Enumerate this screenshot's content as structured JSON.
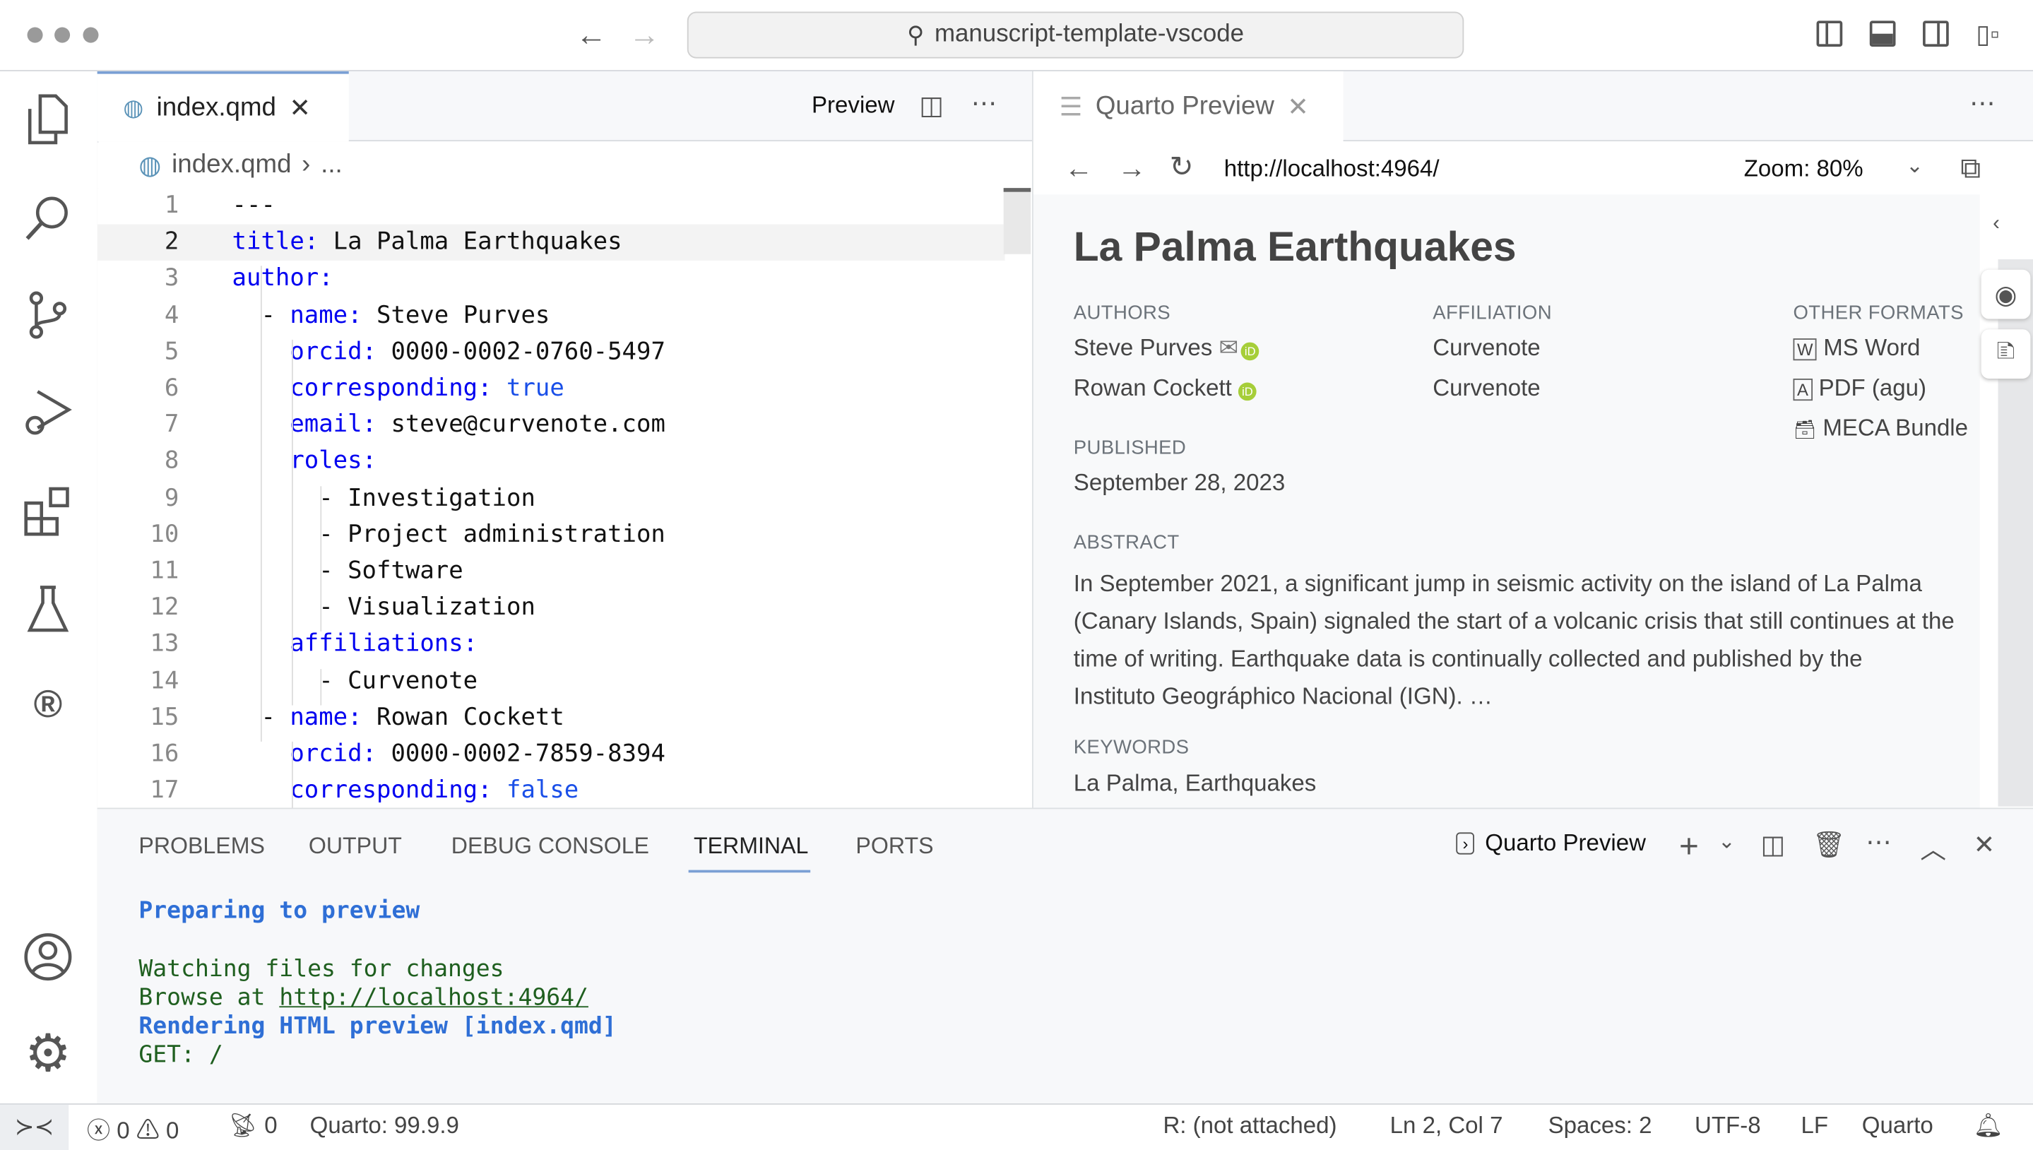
{
  "titlebar": {
    "search_text": "manuscript-template-vscode"
  },
  "activity_bar": {
    "items": [
      "explorer-icon",
      "search-icon",
      "source-control-icon",
      "run-debug-icon",
      "extensions-icon",
      "testing-icon",
      "r-icon"
    ],
    "bottom": [
      "account-icon",
      "gear-icon"
    ]
  },
  "editor": {
    "tab_label": "index.qmd",
    "preview_label": "Preview",
    "breadcrumb_file": "index.qmd",
    "breadcrumb_more": "...",
    "lines": [
      {
        "n": "1",
        "indent": "",
        "key": "",
        "val": "---"
      },
      {
        "n": "2",
        "indent": "",
        "key": "title:",
        "val": " La Palma Earthquakes"
      },
      {
        "n": "3",
        "indent": "",
        "key": "author:",
        "val": ""
      },
      {
        "n": "4",
        "indent": "  - ",
        "key": "name:",
        "val": " Steve Purves"
      },
      {
        "n": "5",
        "indent": "    ",
        "key": "orcid:",
        "val": " 0000-0002-0760-5497"
      },
      {
        "n": "6",
        "indent": "    ",
        "key": "corresponding:",
        "bool": " true"
      },
      {
        "n": "7",
        "indent": "    ",
        "key": "email:",
        "val": " steve@curvenote.com"
      },
      {
        "n": "8",
        "indent": "    ",
        "key": "roles:",
        "val": ""
      },
      {
        "n": "9",
        "indent": "      - ",
        "key": "",
        "val": "Investigation"
      },
      {
        "n": "10",
        "indent": "      - ",
        "key": "",
        "val": "Project administration"
      },
      {
        "n": "11",
        "indent": "      - ",
        "key": "",
        "val": "Software"
      },
      {
        "n": "12",
        "indent": "      - ",
        "key": "",
        "val": "Visualization"
      },
      {
        "n": "13",
        "indent": "    ",
        "key": "affiliations:",
        "val": ""
      },
      {
        "n": "14",
        "indent": "      - ",
        "key": "",
        "val": "Curvenote"
      },
      {
        "n": "15",
        "indent": "  - ",
        "key": "name:",
        "val": " Rowan Cockett"
      },
      {
        "n": "16",
        "indent": "    ",
        "key": "orcid:",
        "val": " 0000-0002-7859-8394"
      },
      {
        "n": "17",
        "indent": "    ",
        "key": "corresponding:",
        "bool": " false"
      }
    ]
  },
  "preview": {
    "tab_label": "Quarto Preview",
    "url": "http://localhost:4964/",
    "zoom": "Zoom: 80%",
    "title": "La Palma Earthquakes",
    "authors_label": "AUTHORS",
    "affiliation_label": "AFFILIATION",
    "formats_label": "OTHER FORMATS",
    "authors": [
      {
        "name": "Steve Purves",
        "affiliation": "Curvenote"
      },
      {
        "name": "Rowan Cockett",
        "affiliation": "Curvenote"
      }
    ],
    "formats": [
      "MS Word",
      "PDF (agu)",
      "MECA Bundle"
    ],
    "published_label": "PUBLISHED",
    "published": "September 28, 2023",
    "abstract_label": "ABSTRACT",
    "abstract_lines": [
      "In September 2021, a significant jump in seismic activity on the island of La Palma",
      "(Canary Islands, Spain) signaled the start of a volcanic crisis that still continues at the",
      "time of writing. Earthquake data is continually collected and published by the",
      "Instituto Geográphico Nacional (IGN). …"
    ],
    "keywords_label": "KEYWORDS",
    "keywords": "La Palma, Earthquakes",
    "orcid_color": "#a6ce39"
  },
  "panel": {
    "tabs": [
      "PROBLEMS",
      "OUTPUT",
      "DEBUG CONSOLE",
      "TERMINAL",
      "PORTS"
    ],
    "active_tab": "TERMINAL",
    "terminal_name": "Quarto Preview",
    "terminal": {
      "l1": "Preparing to preview",
      "l2": "Watching files for changes",
      "l3_prefix": "Browse at ",
      "l3_link": "http://localhost:4964/",
      "l4": "Rendering HTML preview [index.qmd]",
      "l5": "GET: /"
    },
    "colors": {
      "blue": "#2f6fd6",
      "green": "#1f5f1f"
    }
  },
  "status": {
    "errors": "0",
    "warnings": "0",
    "ports": "0",
    "quarto_version": "Quarto: 99.9.9",
    "r_status": "R: (not attached)",
    "position": "Ln 2, Col 7",
    "spaces": "Spaces: 2",
    "encoding": "UTF-8",
    "eol": "LF",
    "language": "Quarto"
  }
}
